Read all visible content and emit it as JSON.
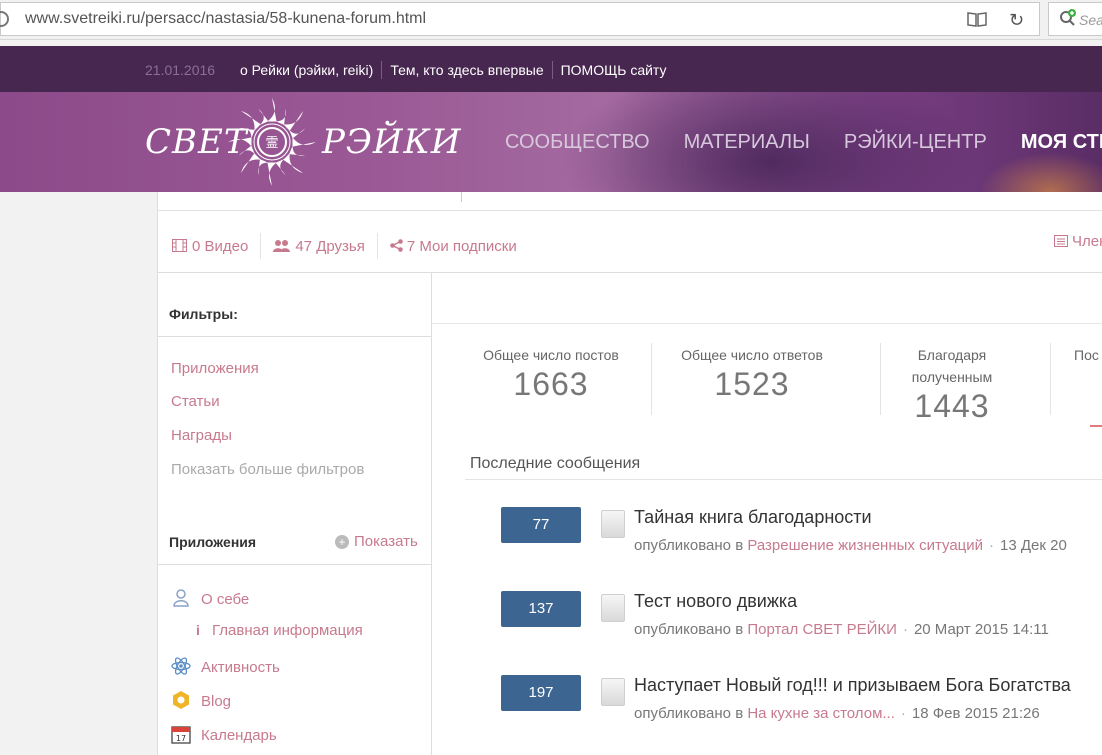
{
  "browser": {
    "url": "www.svetreiki.ru/persacc/nastasia/58-kunena-forum.html",
    "search_placeholder": "Sea"
  },
  "topstrip": {
    "date": "21.01.2016",
    "links": [
      "о Рейки (рэйки, reiki)",
      "Тем, кто здесь впервые",
      "ПОМОЩЬ сайту"
    ]
  },
  "header": {
    "logo_left": "СВЕТ",
    "logo_right": "РЭЙКИ",
    "nav": [
      "СООБЩЕСТВО",
      "МАТЕРИАЛЫ",
      "РЭЙКИ-ЦЕНТР",
      "МОЯ СТР"
    ]
  },
  "profile_stats": {
    "videos": "0 Видео",
    "friends": "47 Друзья",
    "subscriptions": "7 Мои подписки",
    "members": "Член"
  },
  "sidebar": {
    "filters_title": "Фильтры",
    "filters_colon": ":",
    "filters": [
      "Приложения",
      "Статьи",
      "Награды"
    ],
    "more_filters": "Показать больше фильтров",
    "apps_title": "Приложения",
    "show_label": "Показать",
    "apps": [
      "О себе",
      "Главная информация",
      "Активность",
      "Blog",
      "Календарь"
    ]
  },
  "counters": [
    {
      "label": "Общее число постов",
      "value": "1663"
    },
    {
      "label": "Общее число ответов",
      "value": "1523"
    },
    {
      "label_line1": "Благодаря",
      "label_line2": "полученным",
      "value": "1443"
    },
    {
      "label": "Пос",
      "value": ""
    }
  ],
  "latest": {
    "title": "Последние сообщения",
    "published_word": "опубликовано в",
    "posts": [
      {
        "count": "77",
        "title": "Тайная книга благодарности",
        "category": "Разрешение жизненных ситуаций",
        "date": "13 Дек 20"
      },
      {
        "count": "137",
        "title": "Тест нового движка",
        "category": "Портал СВЕТ РЕЙКИ",
        "date": "20 Март 2015 14:11"
      },
      {
        "count": "197",
        "title": "Наступает Новый год!!! и призываем Бога Богатства",
        "category": "На кухне за столом...",
        "date": "18 Фев 2015 21:26"
      }
    ]
  },
  "colors": {
    "accent_pink": "#c77a8e",
    "badge_blue": "#3d6592",
    "top_purple": "#47264f"
  }
}
